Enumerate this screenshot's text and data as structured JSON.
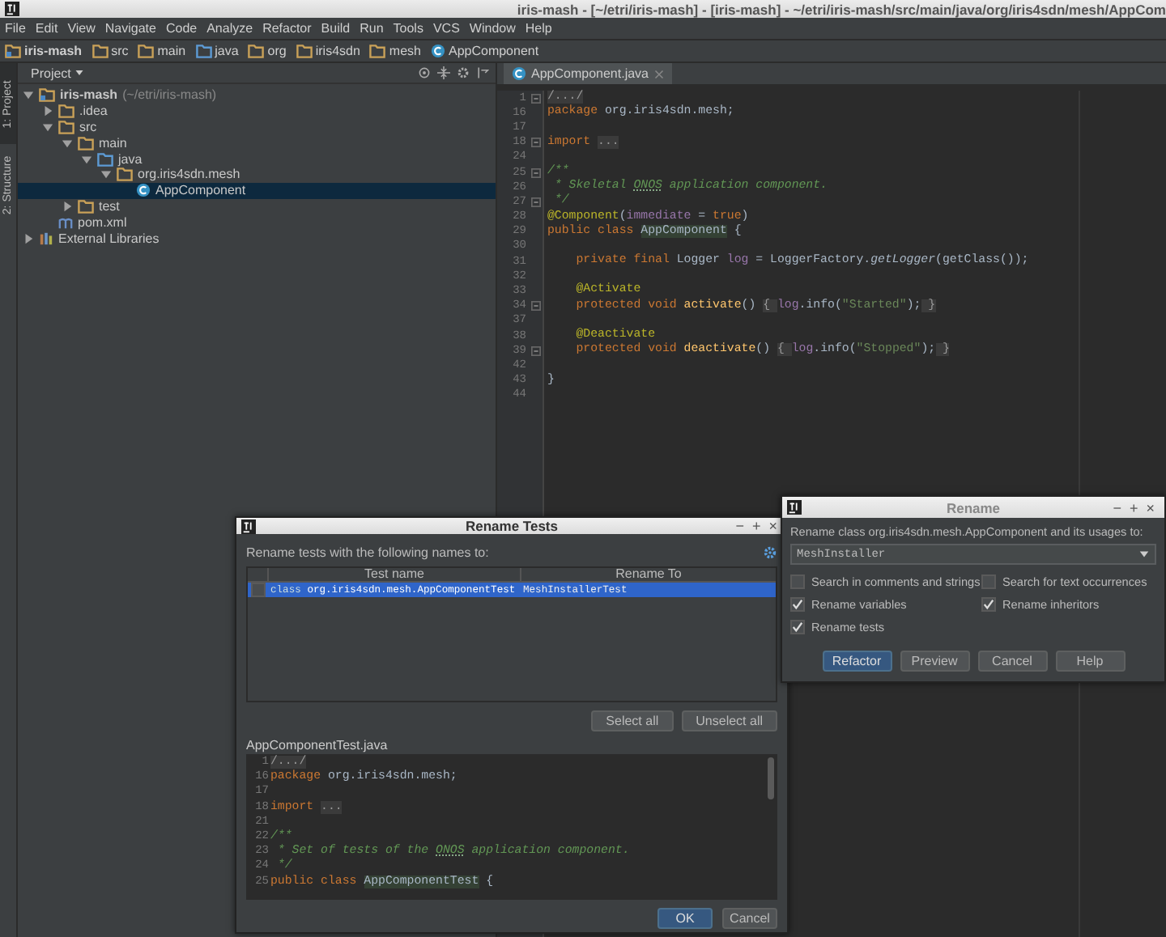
{
  "window": {
    "title": "iris-mash - [~/etri/iris-mash] - [iris-mash] - ~/etri/iris-mash/src/main/java/org/iris4sdn/mesh/AppCom"
  },
  "menu": [
    "File",
    "Edit",
    "View",
    "Navigate",
    "Code",
    "Analyze",
    "Refactor",
    "Build",
    "Run",
    "Tools",
    "VCS",
    "Window",
    "Help"
  ],
  "breadcrumb": [
    {
      "label": "iris-mash",
      "kind": "module"
    },
    {
      "label": "src",
      "kind": "folder"
    },
    {
      "label": "main",
      "kind": "folder"
    },
    {
      "label": "java",
      "kind": "source"
    },
    {
      "label": "org",
      "kind": "folder"
    },
    {
      "label": "iris4sdn",
      "kind": "folder"
    },
    {
      "label": "mesh",
      "kind": "folder"
    },
    {
      "label": "AppComponent",
      "kind": "class"
    }
  ],
  "tool_strip": [
    {
      "label": "1: Project",
      "selected": true
    },
    {
      "label": "2: Structure",
      "selected": false
    }
  ],
  "project_panel": {
    "title": "Project",
    "tree": [
      {
        "label": "iris-mash",
        "note": "(~/etri/iris-mash)",
        "kind": "module",
        "expanded": true,
        "selected": false,
        "children": [
          {
            "label": ".idea",
            "kind": "folder",
            "expanded": false,
            "selected": false
          },
          {
            "label": "src",
            "kind": "folder",
            "expanded": true,
            "selected": false,
            "children": [
              {
                "label": "main",
                "kind": "folder",
                "expanded": true,
                "selected": false,
                "children": [
                  {
                    "label": "java",
                    "kind": "source",
                    "expanded": true,
                    "selected": false,
                    "children": [
                      {
                        "label": "org.iris4sdn.mesh",
                        "kind": "package",
                        "expanded": true,
                        "selected": false,
                        "children": [
                          {
                            "label": "AppComponent",
                            "kind": "class",
                            "selected": true
                          }
                        ]
                      }
                    ]
                  }
                ]
              },
              {
                "label": "test",
                "kind": "folder",
                "expanded": false,
                "selected": false
              }
            ]
          },
          {
            "label": "pom.xml",
            "kind": "maven",
            "selected": false
          }
        ]
      },
      {
        "label": "External Libraries",
        "kind": "library",
        "expanded": false,
        "selected": false
      }
    ]
  },
  "editor": {
    "tabs": [
      {
        "label": "AppComponent.java",
        "selected": true
      }
    ],
    "lines": [
      {
        "num": "1",
        "fold_marker": true,
        "tokens": [
          {
            "kind": "fold",
            "text": "/.../"
          }
        ]
      },
      {
        "num": "16",
        "fold_marker": false,
        "tokens": [
          {
            "kind": "kw",
            "text": "package "
          },
          {
            "kind": "plain",
            "text": "org.iris4sdn.mesh;"
          }
        ]
      },
      {
        "num": "17",
        "fold_marker": false
      },
      {
        "num": "18",
        "fold_marker": true,
        "tokens": [
          {
            "kind": "kw",
            "text": "import "
          },
          {
            "kind": "fold",
            "text": "..."
          }
        ]
      },
      {
        "num": "24",
        "fold_marker": false
      },
      {
        "num": "25",
        "fold_marker": true,
        "tokens": [
          {
            "kind": "comment",
            "text": "/**"
          }
        ]
      },
      {
        "num": "26",
        "fold_marker": false,
        "tokens": [
          {
            "kind": "comment",
            "text": " * Skeletal "
          },
          {
            "kind": "typo",
            "text": "ONOS"
          },
          {
            "kind": "comment",
            "text": " application component."
          }
        ]
      },
      {
        "num": "27",
        "fold_marker": true,
        "tokens": [
          {
            "kind": "comment",
            "text": " */"
          }
        ]
      },
      {
        "num": "28",
        "fold_marker": false,
        "tokens": [
          {
            "kind": "annot",
            "text": "@Component"
          },
          {
            "kind": "plain",
            "text": "("
          },
          {
            "kind": "field",
            "text": "immediate"
          },
          {
            "kind": "plain",
            "text": " = "
          },
          {
            "kind": "kw",
            "text": "true"
          },
          {
            "kind": "plain",
            "text": ")"
          }
        ]
      },
      {
        "num": "29",
        "fold_marker": false,
        "tokens": [
          {
            "kind": "kw",
            "text": "public class "
          },
          {
            "kind": "decl",
            "text": "AppComponent"
          },
          {
            "kind": "plain",
            "text": " {"
          }
        ]
      },
      {
        "num": "30",
        "fold_marker": false
      },
      {
        "num": "31",
        "fold_marker": false,
        "tokens": [
          {
            "kind": "kw",
            "text": "    private final "
          },
          {
            "kind": "plain",
            "text": "Logger "
          },
          {
            "kind": "field",
            "text": "log"
          },
          {
            "kind": "plain",
            "text": " = LoggerFactory."
          },
          {
            "kind": "italic",
            "text": "getLogger"
          },
          {
            "kind": "plain",
            "text": "(getClass());"
          }
        ]
      },
      {
        "num": "32",
        "fold_marker": false
      },
      {
        "num": "33",
        "fold_marker": false,
        "tokens": [
          {
            "kind": "annot",
            "text": "    @Activate"
          }
        ]
      },
      {
        "num": "34",
        "fold_marker": true,
        "tokens": [
          {
            "kind": "kw",
            "text": "    protected void "
          },
          {
            "kind": "method",
            "text": "activate"
          },
          {
            "kind": "plain",
            "text": "() "
          },
          {
            "kind": "fold",
            "text": "{ "
          },
          {
            "kind": "field",
            "text": "log"
          },
          {
            "kind": "plain",
            "text": ".info("
          },
          {
            "kind": "string",
            "text": "\"Started\""
          },
          {
            "kind": "plain",
            "text": ");"
          },
          {
            "kind": "fold",
            "text": " }"
          }
        ]
      },
      {
        "num": "37",
        "fold_marker": false
      },
      {
        "num": "38",
        "fold_marker": false,
        "tokens": [
          {
            "kind": "annot",
            "text": "    @Deactivate"
          }
        ]
      },
      {
        "num": "39",
        "fold_marker": true,
        "tokens": [
          {
            "kind": "kw",
            "text": "    protected void "
          },
          {
            "kind": "method",
            "text": "deactivate"
          },
          {
            "kind": "plain",
            "text": "() "
          },
          {
            "kind": "fold",
            "text": "{ "
          },
          {
            "kind": "field",
            "text": "log"
          },
          {
            "kind": "plain",
            "text": ".info("
          },
          {
            "kind": "string",
            "text": "\"Stopped\""
          },
          {
            "kind": "plain",
            "text": ");"
          },
          {
            "kind": "fold",
            "text": " }"
          }
        ]
      },
      {
        "num": "42",
        "fold_marker": false
      },
      {
        "num": "43",
        "fold_marker": false,
        "tokens": [
          {
            "kind": "plain",
            "text": "}"
          }
        ]
      },
      {
        "num": "44",
        "fold_marker": false
      }
    ]
  },
  "rename_tests_dialog": {
    "title": "Rename Tests",
    "controls": [
      "−",
      "+",
      "×"
    ],
    "prompt": "Rename tests with the following names to:",
    "columns": [
      "Test name",
      "Rename To"
    ],
    "rows": [
      {
        "checked": false,
        "selected": true,
        "kind_label": "class",
        "name": "org.iris4sdn.mesh.AppComponentTest",
        "rename_to": "MeshInstallerTest"
      }
    ],
    "buttons": [
      "Select all",
      "Unselect all"
    ],
    "preview_file": "AppComponentTest.java",
    "preview_lines": [
      {
        "num": "1",
        "tokens": [
          {
            "kind": "fold",
            "text": "/.../"
          }
        ]
      },
      {
        "num": "16",
        "tokens": [
          {
            "kind": "kw",
            "text": "package "
          },
          {
            "kind": "plain",
            "text": "org.iris4sdn.mesh;"
          }
        ]
      },
      {
        "num": "17"
      },
      {
        "num": "18",
        "tokens": [
          {
            "kind": "kw",
            "text": "import "
          },
          {
            "kind": "fold",
            "text": "..."
          }
        ]
      },
      {
        "num": "21"
      },
      {
        "num": "22",
        "tokens": [
          {
            "kind": "comment",
            "text": "/**"
          }
        ]
      },
      {
        "num": "23",
        "tokens": [
          {
            "kind": "comment",
            "text": " * Set of tests of the "
          },
          {
            "kind": "typo",
            "text": "ONOS"
          },
          {
            "kind": "comment",
            "text": " application component."
          }
        ]
      },
      {
        "num": "24",
        "tokens": [
          {
            "kind": "comment",
            "text": " */"
          }
        ]
      },
      {
        "num": "25",
        "tokens": [
          {
            "kind": "kw",
            "text": "public class "
          },
          {
            "kind": "decl",
            "text": "AppComponentTest"
          },
          {
            "kind": "plain",
            "text": " {"
          }
        ]
      }
    ],
    "footer_buttons": [
      {
        "label": "OK",
        "default": true
      },
      {
        "label": "Cancel",
        "default": false
      }
    ]
  },
  "rename_dialog": {
    "title": "Rename",
    "controls": [
      "−",
      "+",
      "×"
    ],
    "prompt": "Rename class org.iris4sdn.mesh.AppComponent and its usages to:",
    "value": "MeshInstaller",
    "options": [
      {
        "label": "Search in comments and strings",
        "checked": false
      },
      {
        "label": "Search for text occurrences",
        "checked": false
      },
      {
        "label": "Rename variables",
        "checked": true
      },
      {
        "label": "Rename inheritors",
        "checked": true
      },
      {
        "label": "Rename tests",
        "checked": true
      }
    ],
    "buttons": [
      {
        "label": "Refactor",
        "default": true
      },
      {
        "label": "Preview",
        "default": false
      },
      {
        "label": "Cancel",
        "default": false
      },
      {
        "label": "Help",
        "default": false
      }
    ]
  }
}
